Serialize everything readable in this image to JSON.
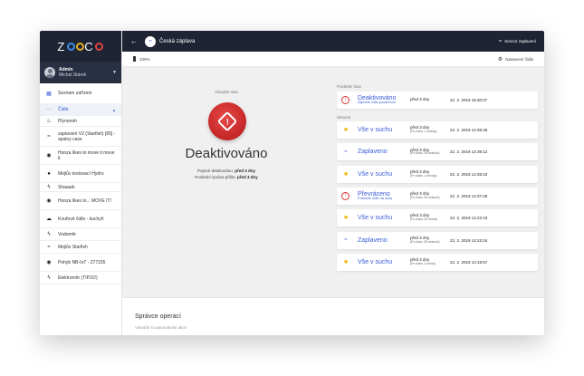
{
  "app": {
    "logo_letters": [
      "Z",
      "O",
      "O",
      "C",
      "O"
    ],
    "logo_colors": {
      "z": "#ffffff",
      "o1": "#3a8ee6",
      "o2": "#e8b020",
      "c": "#ffffff",
      "o3": "#e04040"
    },
    "user_role": "Admin",
    "user_name": "Michal Stárek",
    "user_chevron_icon": "chevron-down-icon"
  },
  "sidebar": {
    "devices_list_label": "Seznam zařízení",
    "sensors_label": "Čidla",
    "items": [
      {
        "label": "Plynoměr",
        "icon": "flame-icon"
      },
      {
        "label": "zaplavení V2 (Starfish) [65] - spatny case",
        "icon": "wave-icon"
      },
      {
        "label": "Honza likes to move it move it",
        "icon": "eye-icon"
      },
      {
        "label": "Mejlův testovací Hydro",
        "icon": "drop-icon"
      },
      {
        "label": "Shaaark",
        "icon": "bolt-icon"
      },
      {
        "label": "Honza likes to... MOVE IT!",
        "icon": "eye-icon"
      },
      {
        "label": "Kouřové čidlo - kuchyň",
        "icon": "smoke-icon"
      },
      {
        "label": "Vodoměr",
        "icon": "bolt-icon"
      },
      {
        "label": "Mejlův Starfish",
        "icon": "wave-icon"
      },
      {
        "label": "Pohyb NB-IoT - 277155",
        "icon": "eye-icon"
      },
      {
        "label": "Elektroměr (TIP2/2)",
        "icon": "bolt-icon"
      }
    ]
  },
  "header": {
    "title": "Česká záplava",
    "sensor_label": "Senzor zaplavení",
    "battery_label": "100%",
    "battery_level": 1.0,
    "settings_label": "Nastavení čidla"
  },
  "current": {
    "label": "Aktuální stav",
    "state": "Deaktivováno",
    "first_detect_prefix": "Poprvé detekováno: ",
    "first_detect_value": "před 3 dny",
    "last_msg_prefix": "Poslední zpráva přišla: ",
    "last_msg_value": "před 3 dny"
  },
  "history": {
    "last_state_label": "Poslední stav",
    "older_label": "Historie",
    "last": {
      "title": "Deaktivováno",
      "subtitle": "Zapnete čidlo ponořením",
      "ago": "před 3 dny",
      "after": "",
      "date": "22. 2. 2019 15:30:07",
      "icon": "alarm-icon"
    },
    "items": [
      {
        "title": "Vše v suchu",
        "subtitle": "",
        "ago": "před 3 dny",
        "after": "(Po dobu 1 hodiny)",
        "date": "22. 2. 2019 14:39:46",
        "icon": "sun-icon"
      },
      {
        "title": "Zaplaveno",
        "subtitle": "",
        "ago": "před 3 dny",
        "after": "(Po dobu 34 sekund)",
        "date": "22. 2. 2019 14:39:12",
        "icon": "wave-icon"
      },
      {
        "title": "Vše v suchu",
        "subtitle": "",
        "ago": "před 3 dny",
        "after": "(Po dobu 1 minuty)",
        "date": "22. 2. 2019 14:38:10",
        "icon": "sun-icon"
      },
      {
        "title": "Převráceno",
        "subtitle": "Postavte čidlo na nohy",
        "ago": "před 3 dny",
        "after": "(Po dobu 25 sekund)",
        "date": "22. 2. 2019 14:37:49",
        "icon": "alarm-icon"
      },
      {
        "title": "Vše v suchu",
        "subtitle": "",
        "ago": "před 3 dny",
        "after": "(Po dobu 15 minut)",
        "date": "22. 2. 2019 14:22:43",
        "icon": "sun-icon"
      },
      {
        "title": "Zaplaveno",
        "subtitle": "",
        "ago": "před 3 dny",
        "after": "(Po dobu 29 sekund)",
        "date": "22. 2. 2019 14:22:04",
        "icon": "wave-icon"
      },
      {
        "title": "Vše v suchu",
        "subtitle": "",
        "ago": "před 3 dny",
        "after": "(Po dobu 2 minut)",
        "date": "22. 2. 2019 14:18:57",
        "icon": "sun-icon"
      }
    ]
  },
  "operations": {
    "title": "Správce operací",
    "subtitle": "Vytvořte si automatické akce"
  }
}
